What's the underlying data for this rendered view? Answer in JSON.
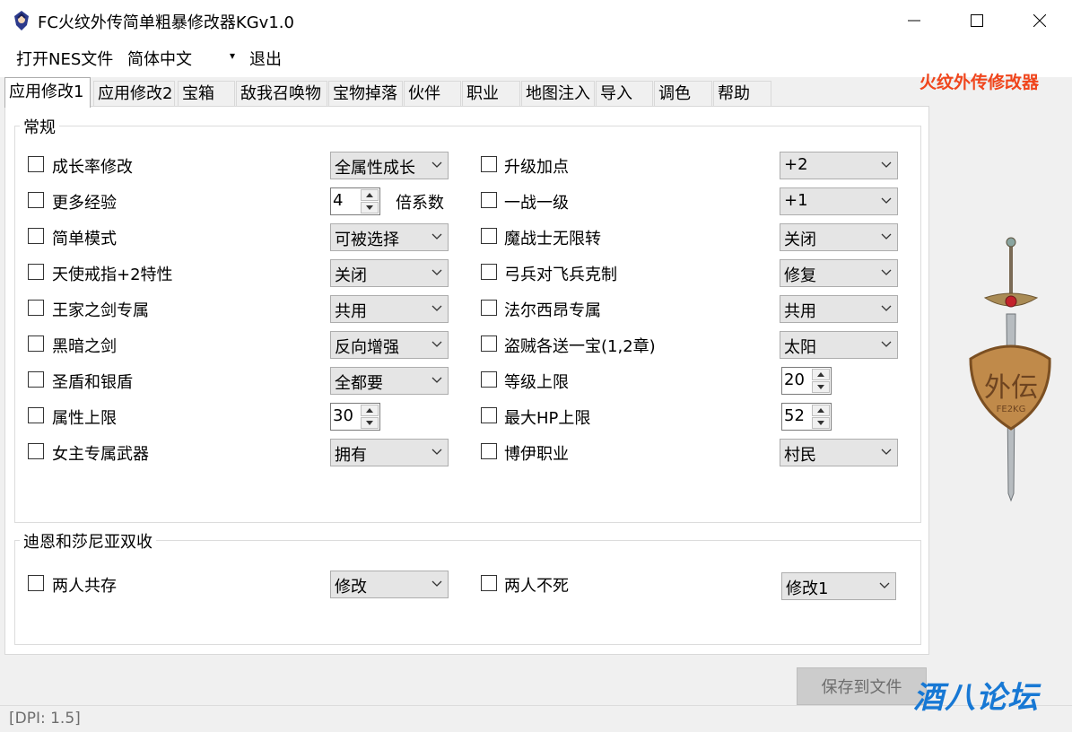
{
  "window": {
    "title": "FC火纹外传简单粗暴修改器KGv1.0",
    "minimize_icon": "minimize-icon",
    "maximize_icon": "maximize-icon",
    "close_icon": "close-icon"
  },
  "menu": {
    "open_label": "打开NES文件",
    "language_value": "简体中文",
    "exit_label": "退出"
  },
  "brand_text": "火纹外传修改器",
  "tabs": [
    "应用修改1",
    "应用修改2",
    "宝箱",
    "敌我召唤物",
    "宝物掉落",
    "伙伴",
    "职业",
    "地图注入",
    "导入",
    "调色",
    "帮助"
  ],
  "active_tab": "应用修改1",
  "group_general": {
    "title": "常规",
    "left": [
      {
        "label": "成长率修改",
        "control": "combo",
        "value": "全属性成长"
      },
      {
        "label": "更多经验",
        "control": "spin",
        "value": "4",
        "suffix": "倍系数"
      },
      {
        "label": "简单模式",
        "control": "combo",
        "value": "可被选择"
      },
      {
        "label": "天使戒指+2特性",
        "control": "combo",
        "value": "关闭"
      },
      {
        "label": "王家之剑专属",
        "control": "combo",
        "value": "共用"
      },
      {
        "label": "黑暗之剑",
        "control": "combo",
        "value": "反向增强"
      },
      {
        "label": "圣盾和银盾",
        "control": "combo",
        "value": "全都要"
      },
      {
        "label": "属性上限",
        "control": "spin",
        "value": "30"
      },
      {
        "label": "女主专属武器",
        "control": "combo",
        "value": "拥有"
      }
    ],
    "right": [
      {
        "label": "升级加点",
        "control": "combo",
        "value": "+2"
      },
      {
        "label": "一战一级",
        "control": "combo",
        "value": "+1"
      },
      {
        "label": "魔战士无限转",
        "control": "combo",
        "value": "关闭"
      },
      {
        "label": "弓兵对飞兵克制",
        "control": "combo",
        "value": "修复"
      },
      {
        "label": "法尔西昂专属",
        "control": "combo",
        "value": "共用"
      },
      {
        "label": "盗贼各送一宝(1,2章)",
        "control": "combo",
        "value": "太阳"
      },
      {
        "label": "等级上限",
        "control": "spin",
        "value": "20"
      },
      {
        "label": "最大HP上限",
        "control": "spin",
        "value": "52"
      },
      {
        "label": "博伊职业",
        "control": "combo",
        "value": "村民"
      }
    ]
  },
  "group_dual": {
    "title": "迪恩和莎尼亚双收",
    "left": {
      "label": "两人共存",
      "value": "修改"
    },
    "right": {
      "label": "两人不死",
      "value": "修改1"
    }
  },
  "save_button": "保存到文件",
  "status": "[DPI: 1.5]",
  "watermark": "酒八论坛",
  "logo": {
    "emblem_text": "外伝",
    "emblem_subtext": "FE2KG"
  },
  "colors": {
    "brand": "#f0451c",
    "watermark": "#1778d4",
    "combo_bg": "#e5e5e5"
  }
}
